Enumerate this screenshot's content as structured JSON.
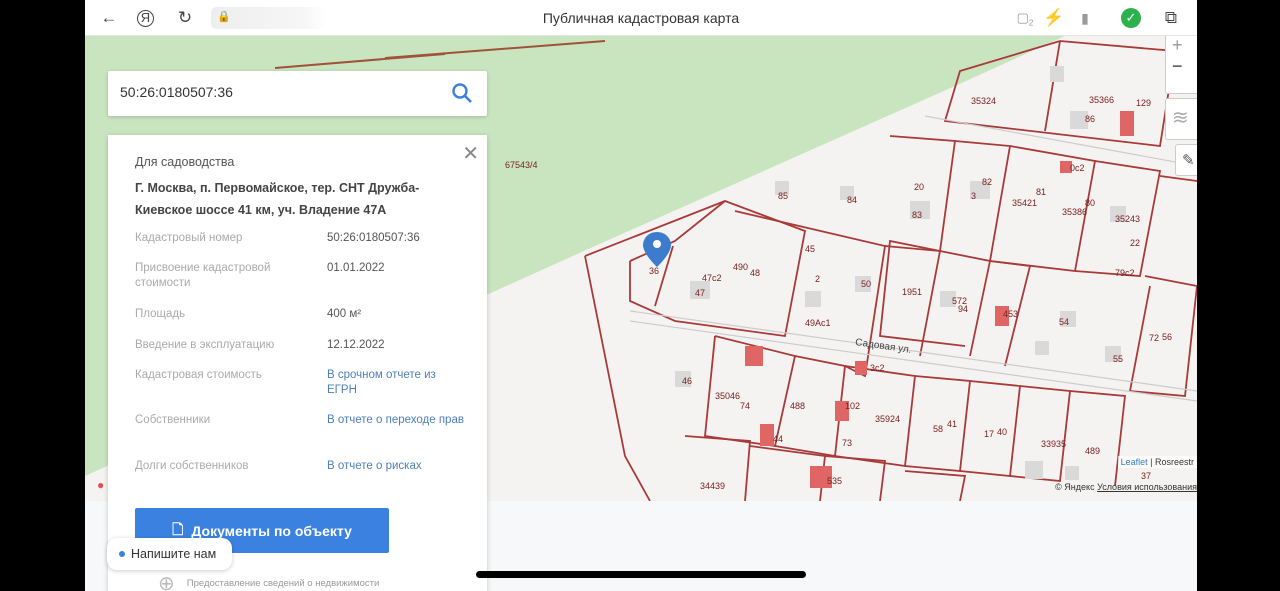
{
  "browser": {
    "title": "Публичная кадастровая карта",
    "tab_count": "2"
  },
  "search": {
    "value": "50:26:0180507:36"
  },
  "panel": {
    "purpose": "Для садоводства",
    "address": "Г. Москва, п. Первомайское, тер. СНТ Дружба-Киевское шоссе 41 км, уч. Владение 47А",
    "rows": [
      {
        "key": "Кадастровый номер",
        "value": "50:26:0180507:36"
      },
      {
        "key": "Присвоение кадастровой стоимости",
        "value": "01.01.2022"
      },
      {
        "key": "Площадь",
        "value": "400 м²"
      },
      {
        "key": "Введение в эксплуатацию",
        "value": "12.12.2022"
      },
      {
        "key": "Кадастровая стоимость",
        "value": "В срочном отчете из ЕГРН"
      },
      {
        "key": "Собственники",
        "value": "В отчете о переходе прав"
      },
      {
        "key": "Долги собственников",
        "value": "В отчете о рисках"
      }
    ],
    "docs_button": "Документы по объекту",
    "footer": "Предоставление сведений о недвижимости"
  },
  "chat": {
    "label": "Напишите нам"
  },
  "map": {
    "street": "Садовая ул.",
    "attribution_leaflet": "Leaflet",
    "attribution_rosreestr": "Rosreestr",
    "attribution_yandex": "© Яндекс",
    "terms": "Условия использования",
    "labels": [
      "67543/4",
      "36",
      "47c2",
      "490",
      "48",
      "45",
      "2",
      "47",
      "49Ac1",
      "85",
      "84",
      "20",
      "83",
      "3",
      "82",
      "81",
      "35421",
      "35386",
      "80",
      "35243",
      "0c2",
      "35324",
      "35366",
      "86",
      "129",
      "50",
      "1951",
      "572",
      "94",
      "453",
      "54",
      "79c2",
      "55",
      "72",
      "56",
      "22",
      "46",
      "35046",
      "74",
      "488",
      "102",
      "3c2",
      "35924",
      "58",
      "41",
      "17",
      "40",
      "33935",
      "489",
      "37",
      "44",
      "73",
      "34439",
      "535"
    ],
    "colors": {
      "forest": "#c9e5c0",
      "parcel_line": "#a83a3a",
      "building": "#d9d9d9",
      "building_red": "#e06666"
    }
  }
}
